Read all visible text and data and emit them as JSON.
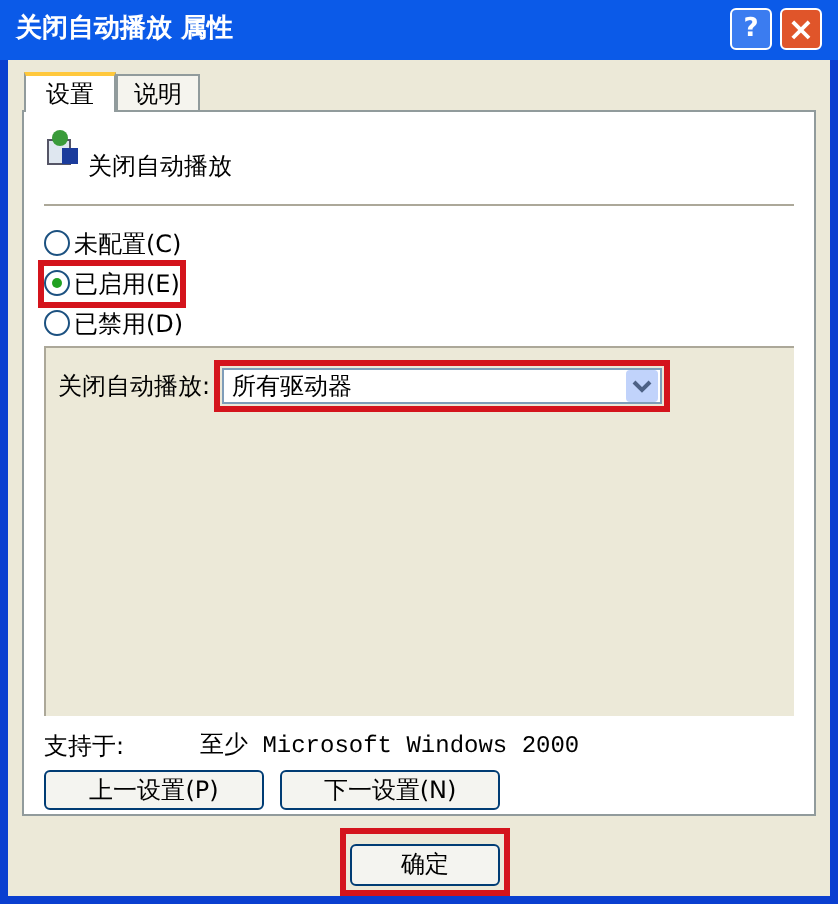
{
  "window": {
    "title": "关闭自动播放 属性",
    "help_button": "?",
    "close_button": "×"
  },
  "tabs": [
    {
      "label": "设置",
      "selected": true
    },
    {
      "label": "说明",
      "selected": false
    }
  ],
  "setting": {
    "name": "关闭自动播放"
  },
  "options": [
    {
      "label": "未配置(C)",
      "selected": false,
      "highlighted": false
    },
    {
      "label": "已启用(E)",
      "selected": true,
      "highlighted": true
    },
    {
      "label": "已禁用(D)",
      "selected": false,
      "highlighted": false
    }
  ],
  "option_panel": {
    "label": "关闭自动播放:",
    "dropdown": {
      "value": "所有驱动器",
      "highlighted": true
    }
  },
  "supported": {
    "label": "支持于:",
    "value": "至少 Microsoft Windows 2000"
  },
  "nav_buttons": [
    "上一设置(P)",
    "下一设置(N)"
  ],
  "ok_button": {
    "label": "确定",
    "highlighted": true
  }
}
